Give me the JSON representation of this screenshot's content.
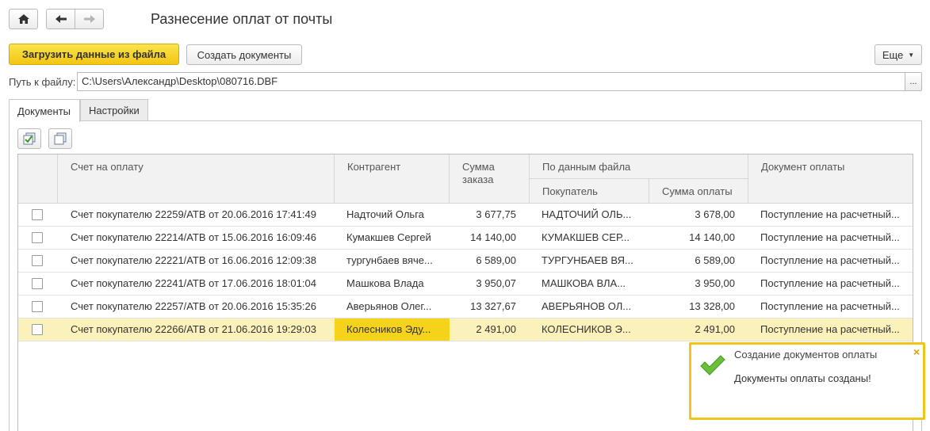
{
  "window": {
    "title": "Разнесение оплат от почты",
    "home_icon": "home-icon",
    "back_icon": "arrow-left-icon",
    "forward_icon": "arrow-right-icon"
  },
  "toolbar": {
    "load_label": "Загрузить данные из файла",
    "create_label": "Создать документы",
    "more_label": "Еще"
  },
  "path": {
    "label": "Путь к файлу:",
    "value": "C:\\Users\\Александр\\Desktop\\080716.DBF",
    "browse_label": "..."
  },
  "tabs": [
    {
      "label": "Документы",
      "active": true
    },
    {
      "label": "Настройки",
      "active": false
    }
  ],
  "grid_toolbar": {
    "check_all_icon": "check-all-icon",
    "uncheck_all_icon": "uncheck-all-icon"
  },
  "columns": {
    "invoice": "Счет на оплату",
    "counterparty": "Контрагент",
    "order_sum": "Сумма заказа",
    "file_group": "По данным файла",
    "buyer": "Покупатель",
    "payment_sum": "Сумма оплаты",
    "payment_doc": "Документ оплаты"
  },
  "rows": [
    {
      "invoice": "Счет покупателю 22259/АТВ от 20.06.2016 17:41:49",
      "counterparty": "Надточий Ольга",
      "order_sum": "3 677,75",
      "buyer": "НАДТОЧИЙ ОЛЬ...",
      "payment_sum": "3 678,00",
      "payment_doc": "Поступление на расчетный..."
    },
    {
      "invoice": "Счет покупателю 22214/АТВ от 15.06.2016 16:09:46",
      "counterparty": "Кумакшев Сергей",
      "order_sum": "14 140,00",
      "buyer": "КУМАКШЕВ СЕР...",
      "payment_sum": "14 140,00",
      "payment_doc": "Поступление на расчетный..."
    },
    {
      "invoice": "Счет покупателю 22221/АТВ от 16.06.2016 12:09:38",
      "counterparty": "тургунбаев вяче...",
      "order_sum": "6 589,00",
      "buyer": "ТУРГУНБАЕВ ВЯ...",
      "payment_sum": "6 589,00",
      "payment_doc": "Поступление на расчетный..."
    },
    {
      "invoice": "Счет покупателю 22241/АТВ от 17.06.2016 18:01:04",
      "counterparty": "Машкова Влада",
      "order_sum": "3 950,07",
      "buyer": "МАШКОВА ВЛА...",
      "payment_sum": "3 950,00",
      "payment_doc": "Поступление на расчетный..."
    },
    {
      "invoice": "Счет покупателю 22257/АТВ от 20.06.2016 15:35:26",
      "counterparty": "Аверьянов Олег...",
      "order_sum": "13 327,67",
      "buyer": "АВЕРЬЯНОВ ОЛ...",
      "payment_sum": "13 328,00",
      "payment_doc": "Поступление на расчетный..."
    },
    {
      "invoice": "Счет покупателю 22266/АТВ от 21.06.2016 19:29:03",
      "counterparty": "Колесников Эду...",
      "order_sum": "2 491,00",
      "buyer": "КОЛЕСНИКОВ Э...",
      "payment_sum": "2 491,00",
      "payment_doc": "Поступление на расчетный..."
    }
  ],
  "notification": {
    "title": "Создание документов оплаты",
    "message": "Документы оплаты созданы!",
    "icon": "checkmark-icon",
    "close_icon": "close-icon"
  },
  "colors": {
    "accent_yellow": "#f3c513",
    "selected_row": "#fbf2bb",
    "selected_cell": "#f5d31b",
    "check_green": "#5aa832"
  }
}
